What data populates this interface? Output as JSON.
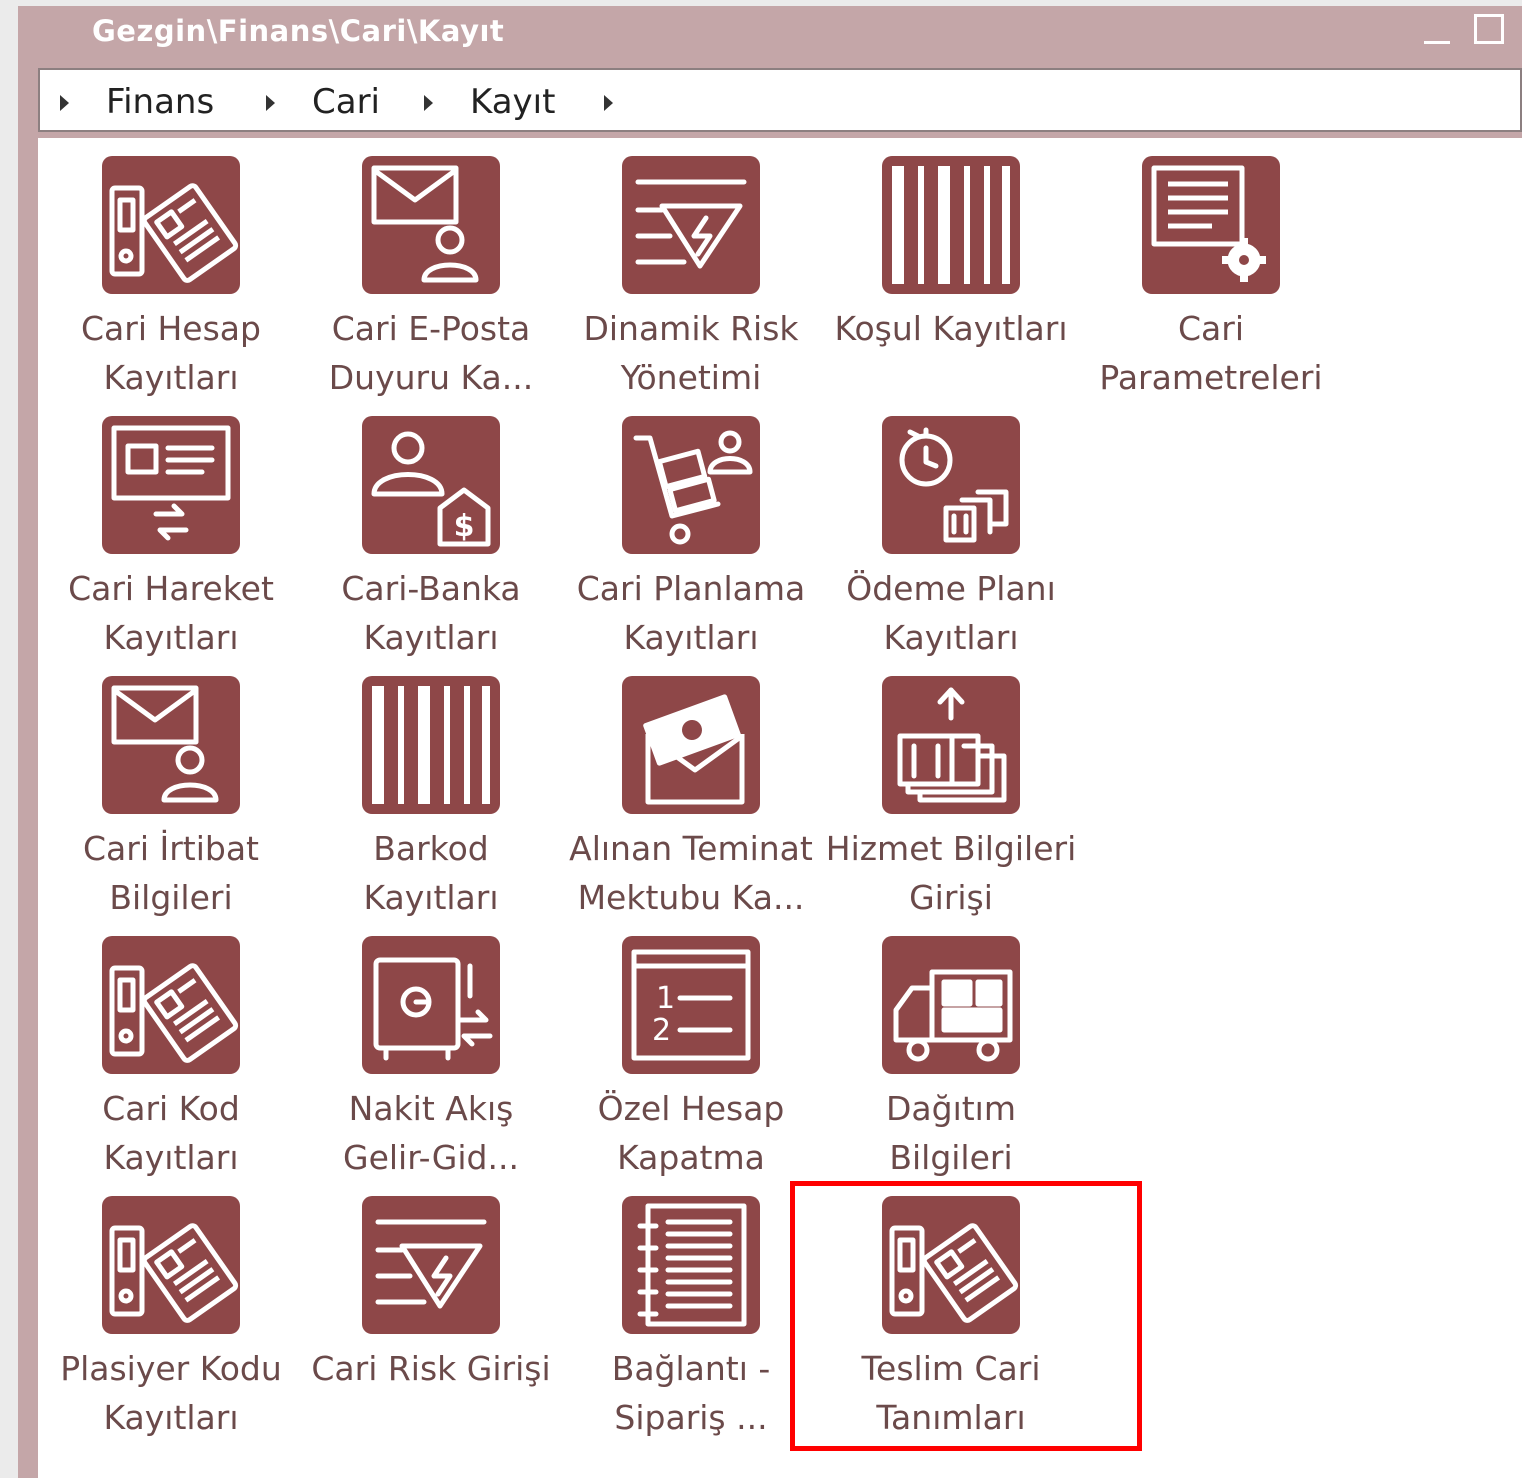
{
  "window": {
    "title": "Gezgin\\Finans\\Cari\\Kayıt"
  },
  "breadcrumb": [
    "Finans",
    "Cari",
    "Kayıt"
  ],
  "tiles": [
    {
      "label": "Cari Hesap\nKayıtları",
      "icon": "binder-card-icon"
    },
    {
      "label": "Cari E-Posta\nDuyuru Ka...",
      "icon": "mail-person-icon"
    },
    {
      "label": "Dinamik Risk\nYönetimi",
      "icon": "risk-warning-icon"
    },
    {
      "label": "Koşul Kayıtları",
      "icon": "barcode-icon"
    },
    {
      "label": "Cari\nParametreleri",
      "icon": "document-gear-icon"
    },
    {
      "label": "Cari Hareket\nKayıtları",
      "icon": "card-exchange-icon"
    },
    {
      "label": "Cari-Banka\nKayıtları",
      "icon": "person-bank-icon"
    },
    {
      "label": "Cari Planlama\nKayıtları",
      "icon": "hand-truck-person-icon"
    },
    {
      "label": "Ödeme Planı\nKayıtları",
      "icon": "stopwatch-money-icon"
    },
    {
      "label": "Cari İrtibat\nBilgileri",
      "icon": "mail-person-icon"
    },
    {
      "label": "Barkod\nKayıtları",
      "icon": "barcode-icon"
    },
    {
      "label": "Alınan Teminat\nMektubu Ka...",
      "icon": "envelope-money-icon"
    },
    {
      "label": "Hizmet Bilgileri\nGirişi",
      "icon": "money-upload-icon"
    },
    {
      "label": "Cari Kod\nKayıtları",
      "icon": "binder-card-icon"
    },
    {
      "label": "Nakit Akış\nGelir-Gid...",
      "icon": "safe-exchange-icon"
    },
    {
      "label": "Özel Hesap\nKapatma",
      "icon": "numbered-list-icon"
    },
    {
      "label": "Dağıtım\nBilgileri",
      "icon": "delivery-truck-icon"
    },
    {
      "label": "Plasiyer Kodu\nKayıtları",
      "icon": "binder-card-icon"
    },
    {
      "label": "Cari Risk Girişi",
      "icon": "risk-warning-icon"
    },
    {
      "label": "Bağlantı -\nSipariş ...",
      "icon": "notebook-icon"
    },
    {
      "label": "Teslim Cari\nTanımları",
      "icon": "binder-card-icon"
    }
  ],
  "highlight": {
    "tile": "Teslim Cari\nTanımları",
    "color": "#ff0000"
  },
  "colors": {
    "tile_bg": "#8e4748",
    "window_frame": "#c4a6a8",
    "label_text": "#6b4a4a"
  }
}
